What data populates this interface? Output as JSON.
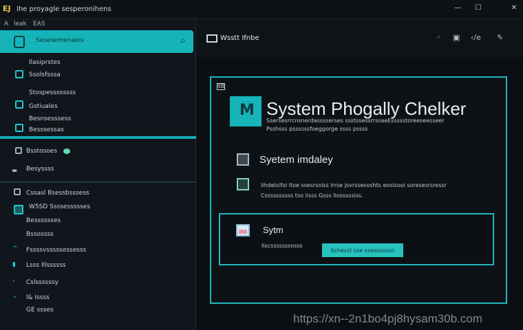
{
  "window": {
    "logo_text": "EJ",
    "title": "Ihe proyagle sesperonihens",
    "controls": {
      "minimize": "—",
      "maximize": "☐",
      "close": "✕"
    }
  },
  "sidebar": {
    "top_letter": "A",
    "top_label": "leak",
    "top_label2": "EAS",
    "search_label": "Sesesemenaeis",
    "items": [
      {
        "label": "Ilasiprstes"
      },
      {
        "label": "Ssolsfsssa"
      },
      {
        "label": "Stospessssssss"
      },
      {
        "label": "Gstiuales"
      },
      {
        "label": "Besnsesssess"
      },
      {
        "label": "Besssessas"
      },
      {
        "label": "Bsstosoes"
      },
      {
        "label": "Besyssss"
      },
      {
        "label": "Cssasl Bsessbsssess"
      },
      {
        "label": "W5SD Ssssessssses"
      },
      {
        "label": "Besssssses"
      },
      {
        "label": "Bssossss"
      },
      {
        "label": "Fssssvsssssessesss"
      },
      {
        "label": "Lsss Illssssss"
      },
      {
        "label": "Cslssssssy"
      },
      {
        "label": "l& Issss"
      },
      {
        "label": "GE ssses"
      }
    ]
  },
  "header": {
    "title": "Wsstt Ifnbe",
    "actions": [
      "◦",
      "▣",
      "‹/e",
      "✎"
    ]
  },
  "panel": {
    "tag": "IIB",
    "logo_letter": "M",
    "title": "System Phogally Chelker",
    "subtitle_1": "Ssersesrrcnsnerdasssserses ssstssessrrssaeEssssstoreeseesseer",
    "subtitle_2": "Psshsss pssssssfoeggorge ssss pssss",
    "section_title": "Syetem imdaley",
    "section_text_1": "Iihdelsifoi ltoe ssesrsolss lrrse jsvrssesoshts eosisooi soresesrsressr",
    "section_text_2": "Cssssssssss tso iisss Gsss Iiosssssiss.",
    "inner": {
      "title": "Sytm",
      "text": "Iiscsssssssosss",
      "button_label": "Schesst sse ssessosssn"
    }
  },
  "watermark": "https://xn--2n1bo4pj8hysam30b.com"
}
